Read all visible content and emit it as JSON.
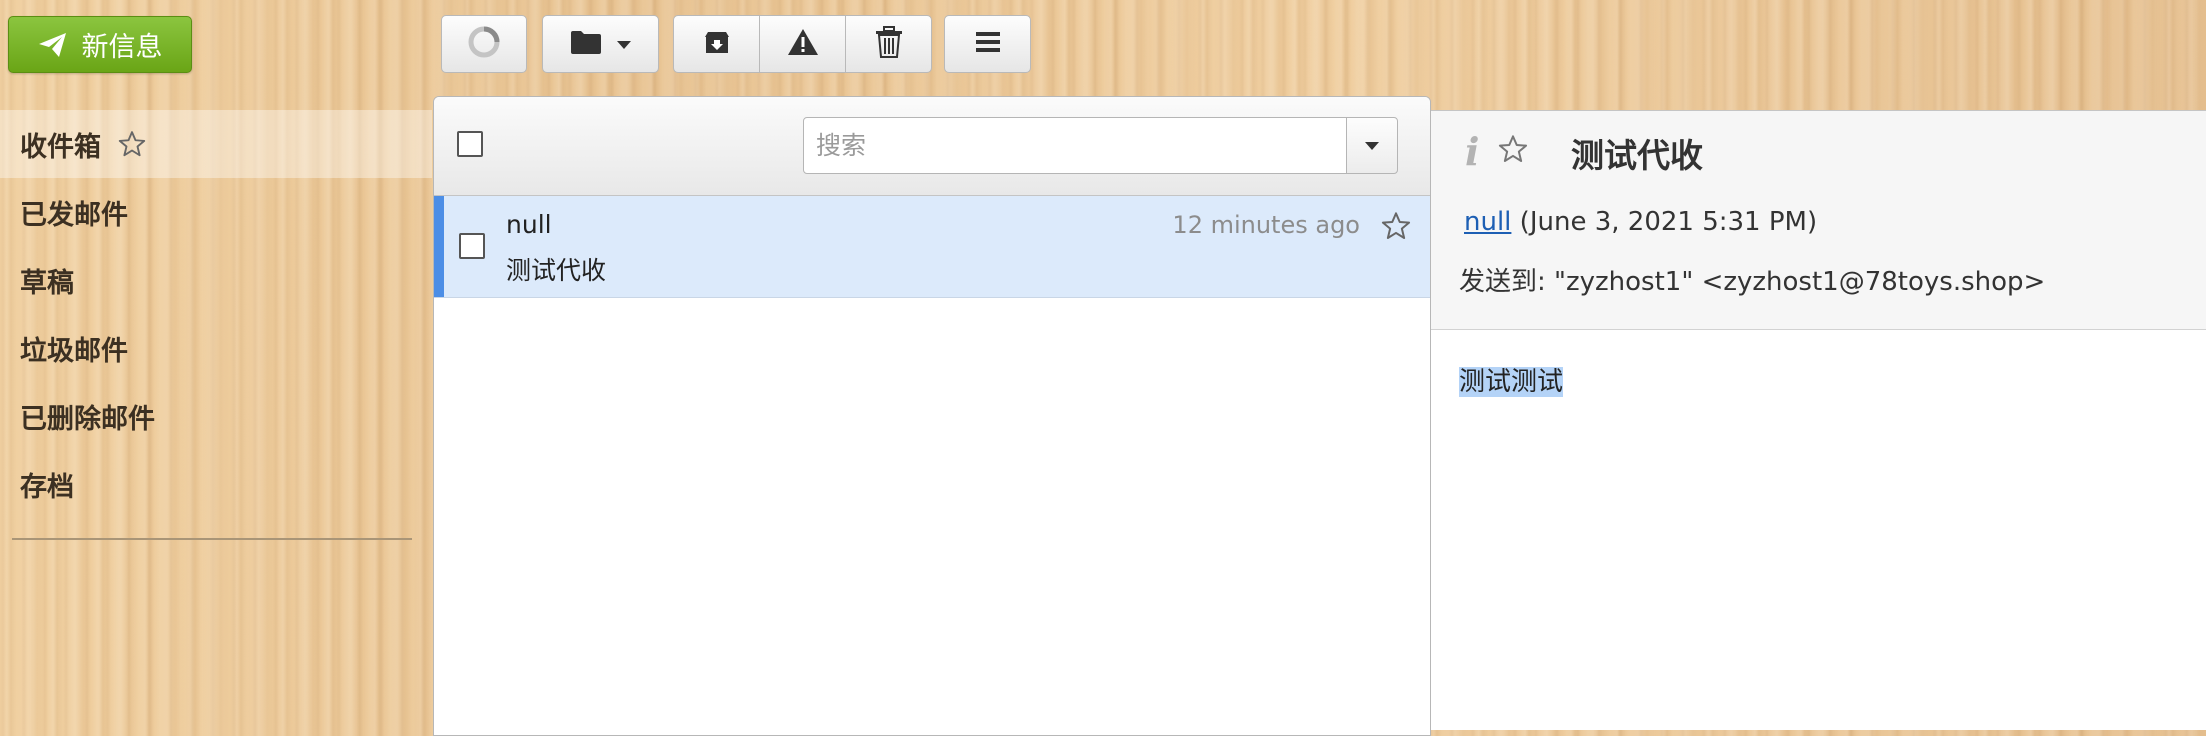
{
  "compose": {
    "label": "新信息",
    "icon": "send-icon",
    "color": "#7ab32e"
  },
  "folders": [
    {
      "label": "收件箱",
      "active": true,
      "starred": false
    },
    {
      "label": "已发邮件"
    },
    {
      "label": "草稿"
    },
    {
      "label": "垃圾邮件"
    },
    {
      "label": "已删除邮件"
    },
    {
      "label": "存档"
    }
  ],
  "toolbar": {
    "buttons": [
      {
        "name": "refresh-button",
        "icon": "refresh-spinner-icon"
      },
      {
        "name": "move-to-folder-button",
        "icon": "folder-icon",
        "dropdown": true
      },
      {
        "name": "archive-button",
        "icon": "archive-icon"
      },
      {
        "name": "report-spam-button",
        "icon": "warning-icon"
      },
      {
        "name": "delete-button",
        "icon": "trash-icon"
      },
      {
        "name": "more-menu-button",
        "icon": "menu-icon"
      }
    ]
  },
  "message_list": {
    "search_placeholder": "搜索",
    "messages": [
      {
        "from": "null",
        "subject": "测试代收",
        "time": "12 minutes ago",
        "selected": true,
        "starred": false
      }
    ],
    "selected_color": "#dceafb",
    "selection_bar_color": "#4c8ee6"
  },
  "preview": {
    "subject": "测试代收",
    "from_name": "null",
    "date": "(June 3, 2021 5:31 PM)",
    "to_label": "发送到:",
    "to_value": "\"zyzhost1\" <zyzhost1@78toys.shop>",
    "body": "测试测试",
    "link_color": "#1d5fb4"
  }
}
